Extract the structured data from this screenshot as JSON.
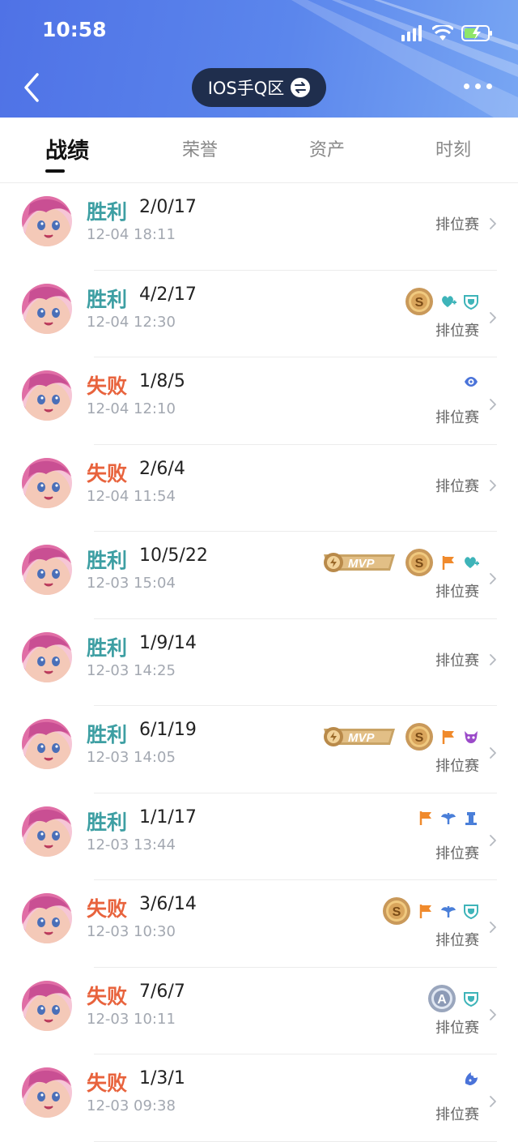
{
  "status_bar": {
    "time": "10:58"
  },
  "header": {
    "server_label": "IOS手Q区"
  },
  "tabs": [
    "战绩",
    "荣誉",
    "资产",
    "时刻"
  ],
  "matches": [
    {
      "result": "胜利",
      "outcome": "win",
      "kda": "2/0/17",
      "datetime": "12-04 18:11",
      "mode": "排位赛",
      "badges": []
    },
    {
      "result": "胜利",
      "outcome": "win",
      "kda": "4/2/17",
      "datetime": "12-04 12:30",
      "mode": "排位赛",
      "badges": [
        "s-coin-icon",
        "heart-plus-icon",
        "shield-icon"
      ]
    },
    {
      "result": "失败",
      "outcome": "loss",
      "kda": "1/8/5",
      "datetime": "12-04 12:10",
      "mode": "排位赛",
      "badges": [
        "eye-ward-icon"
      ]
    },
    {
      "result": "失败",
      "outcome": "loss",
      "kda": "2/6/4",
      "datetime": "12-04 11:54",
      "mode": "排位赛",
      "badges": []
    },
    {
      "result": "胜利",
      "outcome": "win",
      "kda": "10/5/22",
      "datetime": "12-03 15:04",
      "mode": "排位赛",
      "badges": [
        "mvp-badge-icon",
        "s-coin-icon",
        "flag-icon",
        "heart-plus-icon"
      ]
    },
    {
      "result": "胜利",
      "outcome": "win",
      "kda": "1/9/14",
      "datetime": "12-03 14:25",
      "mode": "排位赛",
      "badges": []
    },
    {
      "result": "胜利",
      "outcome": "win",
      "kda": "6/1/19",
      "datetime": "12-03 14:05",
      "mode": "排位赛",
      "badges": [
        "mvp-badge-icon",
        "s-coin-icon",
        "flag-icon",
        "demon-icon"
      ]
    },
    {
      "result": "胜利",
      "outcome": "win",
      "kda": "1/1/17",
      "datetime": "12-03 13:44",
      "mode": "排位赛",
      "badges": [
        "flag-icon",
        "wings-icon",
        "tower-icon"
      ]
    },
    {
      "result": "失败",
      "outcome": "loss",
      "kda": "3/6/14",
      "datetime": "12-03 10:30",
      "mode": "排位赛",
      "badges": [
        "s-coin-icon",
        "flag-icon",
        "wings-icon",
        "shield-icon"
      ]
    },
    {
      "result": "失败",
      "outcome": "loss",
      "kda": "7/6/7",
      "datetime": "12-03 10:11",
      "mode": "排位赛",
      "badges": [
        "a-coin-icon",
        "shield-icon"
      ]
    },
    {
      "result": "失败",
      "outcome": "loss",
      "kda": "1/3/1",
      "datetime": "12-03 09:38",
      "mode": "排位赛",
      "badges": [
        "dragon-icon"
      ]
    }
  ],
  "colors": {
    "win": "#3e9fa3",
    "loss": "#e8633d",
    "header_start": "#4f72e6",
    "header_end": "#78a6f3"
  }
}
